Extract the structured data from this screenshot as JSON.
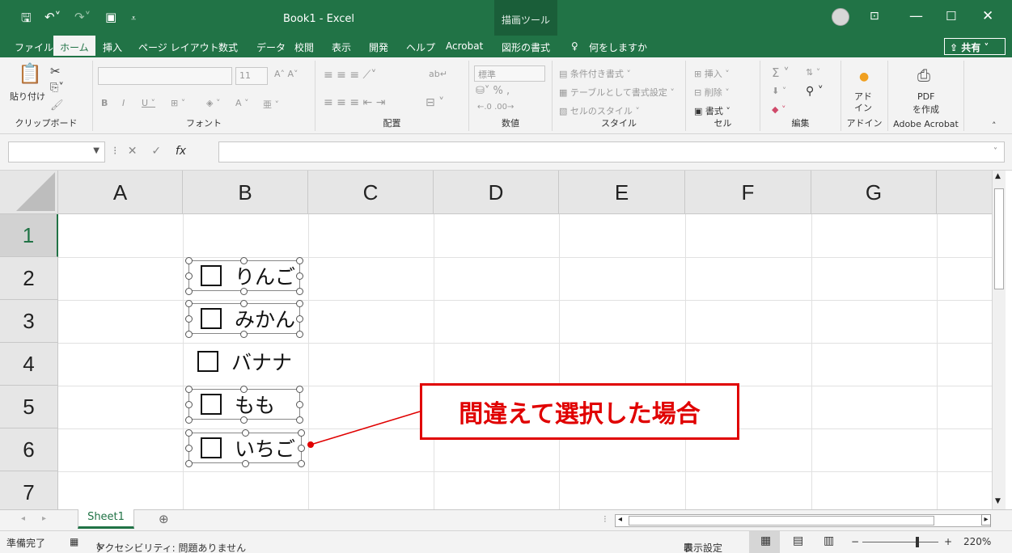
{
  "window": {
    "title": "Book1  -  Excel",
    "context_tab": "描画ツール"
  },
  "ribbon_tabs": [
    "ファイル",
    "ホーム",
    "挿入",
    "ページ レイアウト",
    "数式",
    "データ",
    "校閲",
    "表示",
    "開発",
    "ヘルプ",
    "Acrobat",
    "図形の書式"
  ],
  "active_tab": "ホーム",
  "tell_me": "何をしますか",
  "share": "共有",
  "ribbon": {
    "clipboard": {
      "paste": "貼り付け",
      "label": "クリップボード"
    },
    "font": {
      "size": "11",
      "label": "フォント"
    },
    "alignment": {
      "label": "配置"
    },
    "number": {
      "format": "標準",
      "label": "数値"
    },
    "styles": {
      "conditional": "条件付き書式",
      "table": "テーブルとして書式設定",
      "cell": "セルのスタイル",
      "label": "スタイル"
    },
    "cells": {
      "insert": "挿入",
      "delete": "削除",
      "format": "書式",
      "label": "セル"
    },
    "editing": {
      "label": "編集"
    },
    "addins": {
      "button": "アド\nイン",
      "label": "アドイン"
    },
    "acrobat": {
      "button1": "PDF",
      "button2": "を作成",
      "label": "Adobe Acrobat"
    }
  },
  "formula_bar": {
    "namebox": "",
    "formula": ""
  },
  "columns": [
    "A",
    "B",
    "C",
    "D",
    "E",
    "F",
    "G"
  ],
  "rows": [
    "1",
    "2",
    "3",
    "4",
    "5",
    "6",
    "7"
  ],
  "checkboxes": [
    {
      "label": "りんご",
      "row": 2,
      "selected": true
    },
    {
      "label": "みかん",
      "row": 3,
      "selected": true
    },
    {
      "label": "バナナ",
      "row": 4,
      "selected": false
    },
    {
      "label": "もも",
      "row": 5,
      "selected": true
    },
    {
      "label": "いちご",
      "row": 6,
      "selected": true
    }
  ],
  "annotation": "間違えて選択した場合",
  "sheets": [
    "Sheet1"
  ],
  "status": {
    "ready": "準備完了",
    "accessibility": "アクセシビリティ: 問題ありません",
    "display_settings": "表示設定",
    "zoom": "220%"
  },
  "colors": {
    "accent": "#217346",
    "annotation": "#e00000"
  }
}
